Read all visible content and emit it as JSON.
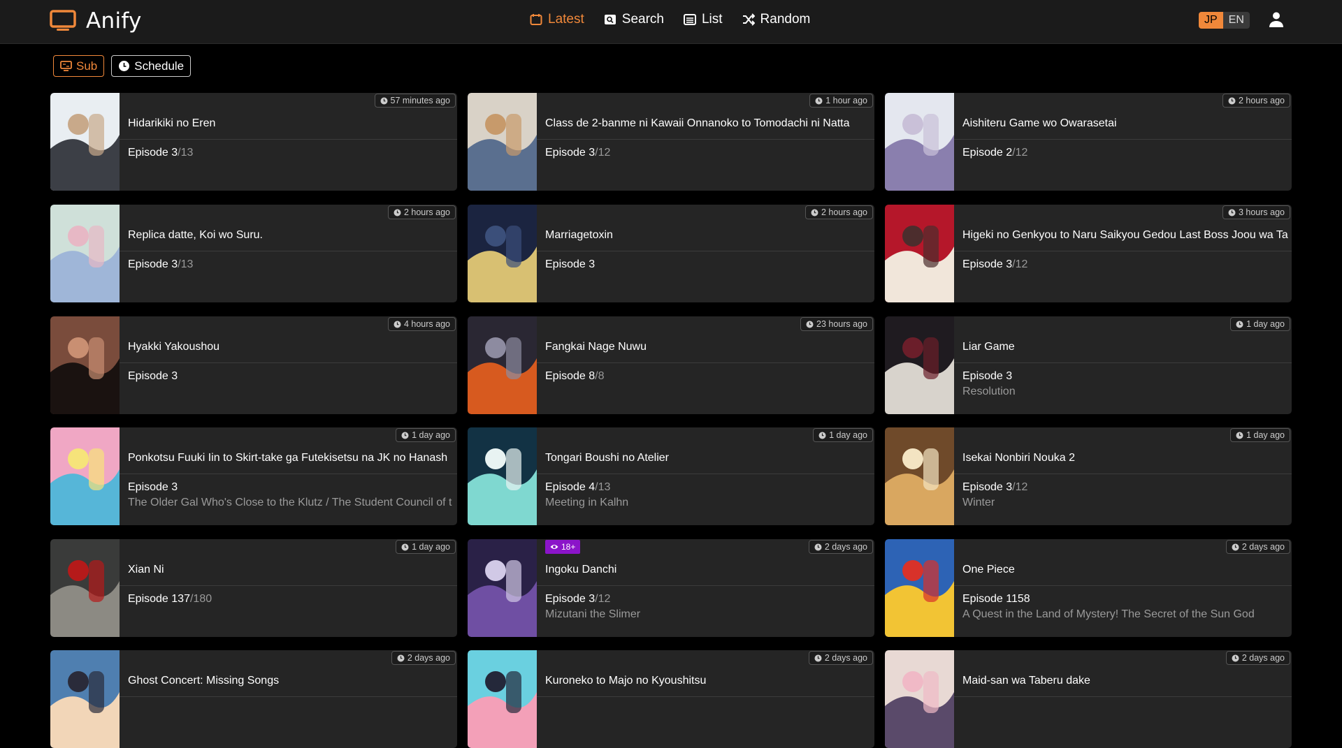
{
  "app": {
    "name": "Anify"
  },
  "nav": [
    {
      "label": "Latest",
      "icon": "calendar-icon",
      "active": true
    },
    {
      "label": "Search",
      "icon": "search-icon",
      "active": false
    },
    {
      "label": "List",
      "icon": "list-icon",
      "active": false
    },
    {
      "label": "Random",
      "icon": "shuffle-icon",
      "active": false
    }
  ],
  "language": {
    "jp": "JP",
    "en": "EN",
    "selected": "JP"
  },
  "filters": {
    "sub": "Sub",
    "schedule": "Schedule"
  },
  "colors": {
    "accent": "#f0883a",
    "adult_badge": "#8b14c9"
  },
  "cards": [
    {
      "title": "Hidarikiki no Eren",
      "time": "57 minutes ago",
      "episode": "Episode 3",
      "total": "/13",
      "ep_title": ""
    },
    {
      "title": "Class de 2-banme ni Kawaii Onnanoko to Tomodachi ni Natta",
      "time": "1 hour ago",
      "episode": "Episode 3",
      "total": "/12",
      "ep_title": ""
    },
    {
      "title": "Aishiteru Game wo Owarasetai",
      "time": "2 hours ago",
      "episode": "Episode 2",
      "total": "/12",
      "ep_title": ""
    },
    {
      "title": "Replica datte, Koi wo Suru.",
      "time": "2 hours ago",
      "episode": "Episode 3",
      "total": "/13",
      "ep_title": ""
    },
    {
      "title": "Marriagetoxin",
      "time": "2 hours ago",
      "episode": "Episode 3",
      "total": "",
      "ep_title": ""
    },
    {
      "title": "Higeki no Genkyou to Naru Saikyou Gedou Last Boss Joou wa Ta",
      "time": "3 hours ago",
      "episode": "Episode 3",
      "total": "/12",
      "ep_title": ""
    },
    {
      "title": "Hyakki Yakoushou",
      "time": "4 hours ago",
      "episode": "Episode 3",
      "total": "",
      "ep_title": ""
    },
    {
      "title": "Fangkai Nage Nuwu",
      "time": "23 hours ago",
      "episode": "Episode 8",
      "total": "/8",
      "ep_title": ""
    },
    {
      "title": "Liar Game",
      "time": "1 day ago",
      "episode": "Episode 3",
      "total": "",
      "ep_title": "Resolution"
    },
    {
      "title": "Ponkotsu Fuuki Iin to Skirt-take ga Futekisetsu na JK no Hanash",
      "time": "1 day ago",
      "episode": "Episode 3",
      "total": "",
      "ep_title": "The Older Gal Who's Close to the Klutz / The Student Council of t"
    },
    {
      "title": "Tongari Boushi no Atelier",
      "time": "1 day ago",
      "episode": "Episode 4",
      "total": "/13",
      "ep_title": "Meeting in Kalhn"
    },
    {
      "title": "Isekai Nonbiri Nouka 2",
      "time": "1 day ago",
      "episode": "Episode 3",
      "total": "/12",
      "ep_title": "Winter"
    },
    {
      "title": "Xian Ni",
      "time": "1 day ago",
      "episode": "Episode 137",
      "total": "/180",
      "ep_title": ""
    },
    {
      "title": "Ingoku Danchi",
      "time": "2 days ago",
      "episode": "Episode 3",
      "total": "/12",
      "ep_title": "Mizutani the Slimer",
      "badge": "18+"
    },
    {
      "title": "One Piece",
      "time": "2 days ago",
      "episode": "Episode 1158",
      "total": "",
      "ep_title": "A Quest in the Land of Mystery! The Secret of the Sun God"
    },
    {
      "title": "Ghost Concert: Missing Songs",
      "time": "2 days ago",
      "episode": "",
      "total": "",
      "ep_title": ""
    },
    {
      "title": "Kuroneko to Majo no Kyoushitsu",
      "time": "2 days ago",
      "episode": "",
      "total": "",
      "ep_title": ""
    },
    {
      "title": "Maid-san wa Taberu dake",
      "time": "2 days ago",
      "episode": "",
      "total": "",
      "ep_title": ""
    }
  ]
}
